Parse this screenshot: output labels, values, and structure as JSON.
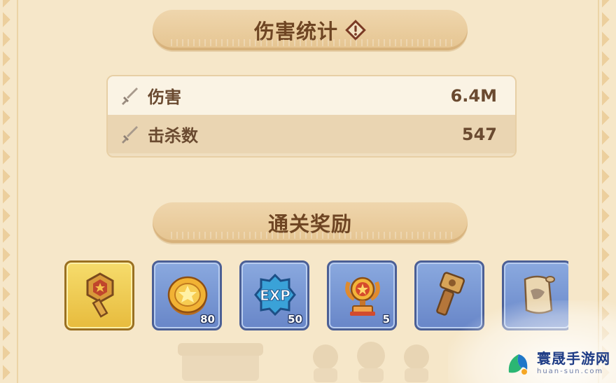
{
  "damage_stats": {
    "title": "伤害统计",
    "rows": [
      {
        "label": "伤害",
        "value": "6.4M",
        "icon": "sword-icon"
      },
      {
        "label": "击杀数",
        "value": "547",
        "icon": "sword-icon"
      }
    ]
  },
  "rewards": {
    "title": "通关奖励",
    "items": [
      {
        "icon": "key-icon",
        "qty": "",
        "style": "gold"
      },
      {
        "icon": "gold-coin-icon",
        "qty": "80",
        "style": "blue"
      },
      {
        "icon": "exp-badge-icon",
        "qty": "50",
        "style": "blue"
      },
      {
        "icon": "trophy-icon",
        "qty": "5",
        "style": "blue"
      },
      {
        "icon": "hammer-icon",
        "qty": "",
        "style": "blue"
      },
      {
        "icon": "scroll-icon",
        "qty": "",
        "style": "blue"
      }
    ],
    "exp_label": "EXP"
  },
  "watermark": {
    "main": "寰晟手游网",
    "sub": "huan-sun.com"
  },
  "colors": {
    "background": "#f6e7c9",
    "header": "#e9cc9c",
    "text_brown": "#6a4a30",
    "reward_blue": "#7796d4",
    "reward_gold": "#f0cd55"
  }
}
